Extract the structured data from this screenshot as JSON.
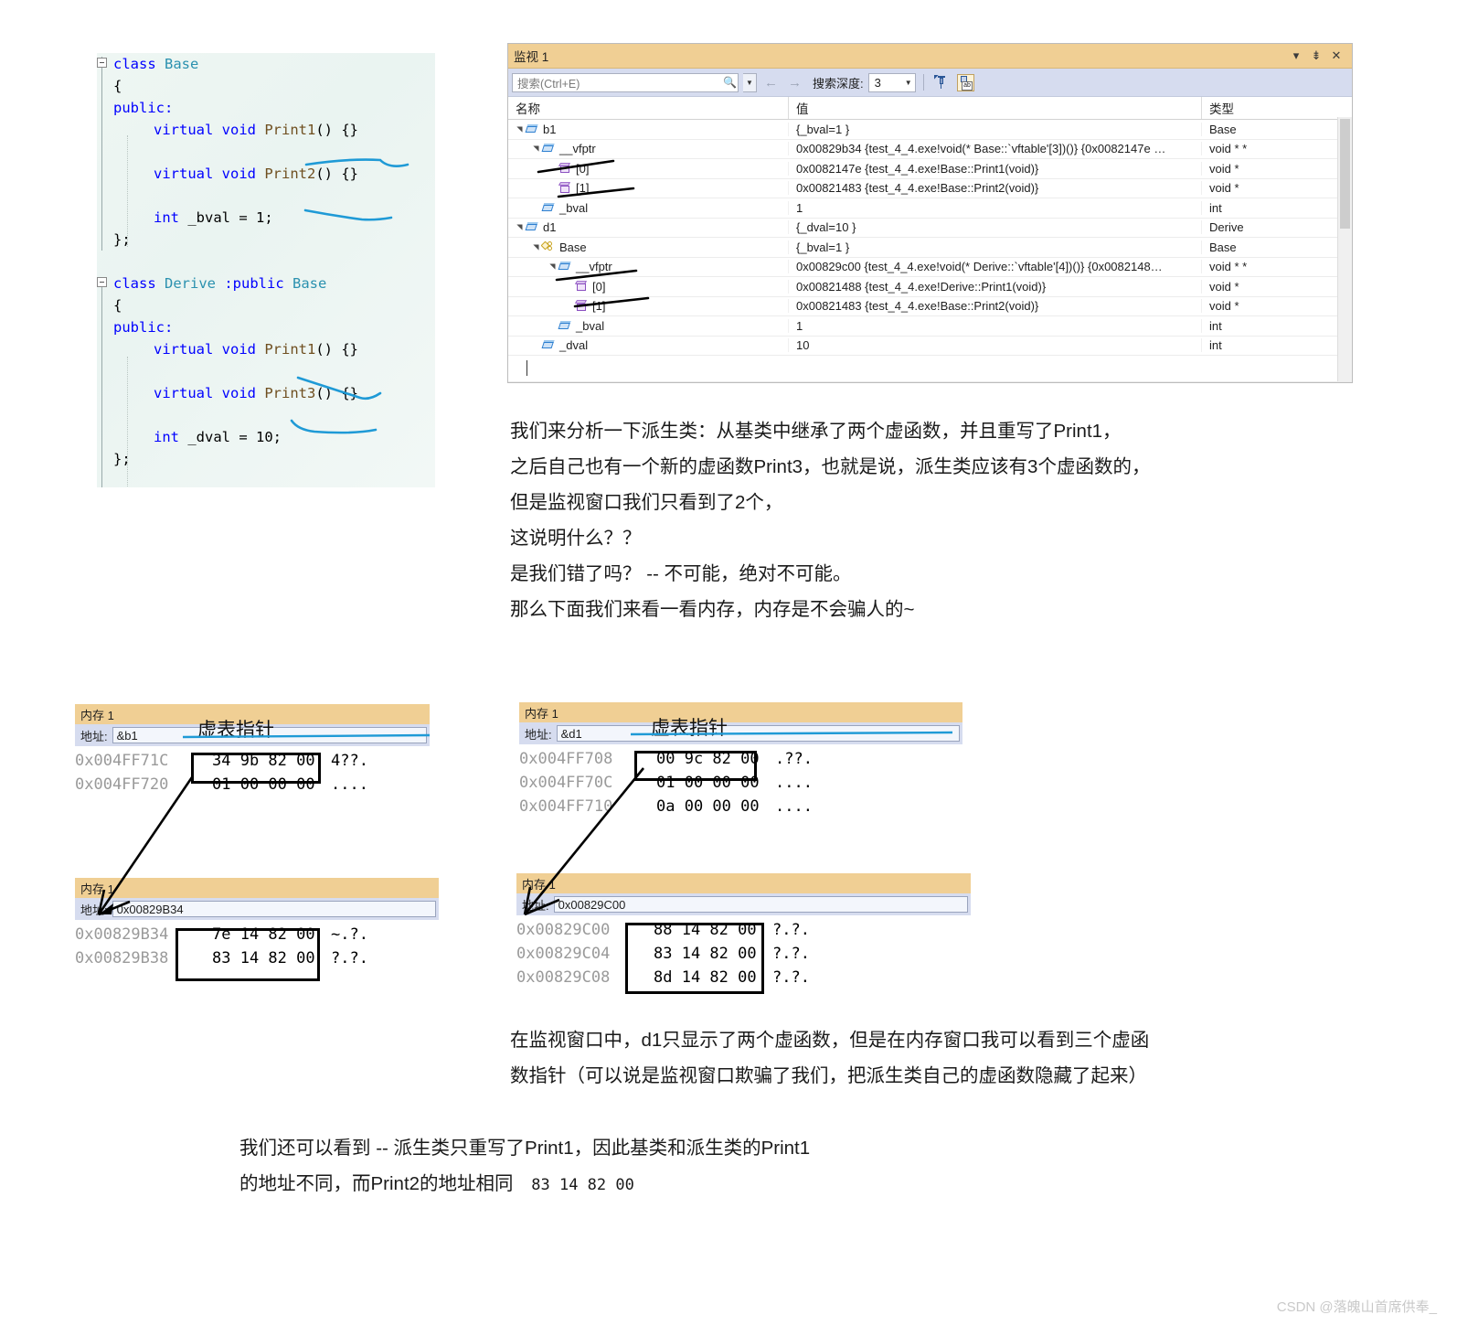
{
  "code_panel": {
    "lines": [
      {
        "indent": 0,
        "fold": true,
        "segs": [
          {
            "t": "class ",
            "c": "kw"
          },
          {
            "t": "Base",
            "c": "type"
          }
        ]
      },
      {
        "indent": 0,
        "fold": false,
        "segs": [
          {
            "t": "{",
            "c": "plain"
          }
        ]
      },
      {
        "indent": 0,
        "fold": false,
        "segs": [
          {
            "t": "public:",
            "c": "kw"
          }
        ]
      },
      {
        "indent": 1,
        "fold": false,
        "segs": [
          {
            "t": "virtual void ",
            "c": "kw"
          },
          {
            "t": "Print1",
            "c": "fn"
          },
          {
            "t": "() {}",
            "c": "plain"
          }
        ]
      },
      {
        "indent": 0,
        "fold": false,
        "segs": []
      },
      {
        "indent": 1,
        "fold": false,
        "segs": [
          {
            "t": "virtual void ",
            "c": "kw"
          },
          {
            "t": "Print2",
            "c": "fn"
          },
          {
            "t": "() {}",
            "c": "plain"
          }
        ]
      },
      {
        "indent": 0,
        "fold": false,
        "segs": []
      },
      {
        "indent": 1,
        "fold": false,
        "segs": [
          {
            "t": "int ",
            "c": "kw"
          },
          {
            "t": "_bval = 1;",
            "c": "plain"
          }
        ]
      },
      {
        "indent": 0,
        "fold": false,
        "segs": [
          {
            "t": "};",
            "c": "plain"
          }
        ]
      },
      {
        "indent": 0,
        "fold": false,
        "segs": []
      },
      {
        "indent": 0,
        "fold": true,
        "segs": [
          {
            "t": "class ",
            "c": "kw"
          },
          {
            "t": "Derive ",
            "c": "type"
          },
          {
            "t": ":public ",
            "c": "kw"
          },
          {
            "t": "Base",
            "c": "type"
          }
        ]
      },
      {
        "indent": 0,
        "fold": false,
        "segs": [
          {
            "t": "{",
            "c": "plain"
          }
        ]
      },
      {
        "indent": 0,
        "fold": false,
        "segs": [
          {
            "t": "public:",
            "c": "kw"
          }
        ]
      },
      {
        "indent": 1,
        "fold": false,
        "segs": [
          {
            "t": "virtual void ",
            "c": "kw"
          },
          {
            "t": "Print1",
            "c": "fn"
          },
          {
            "t": "() {}",
            "c": "plain"
          }
        ]
      },
      {
        "indent": 0,
        "fold": false,
        "segs": []
      },
      {
        "indent": 1,
        "fold": false,
        "segs": [
          {
            "t": "virtual void ",
            "c": "kw"
          },
          {
            "t": "Print3",
            "c": "fn"
          },
          {
            "t": "() {}",
            "c": "plain"
          }
        ]
      },
      {
        "indent": 0,
        "fold": false,
        "segs": []
      },
      {
        "indent": 1,
        "fold": false,
        "segs": [
          {
            "t": "int ",
            "c": "kw"
          },
          {
            "t": "_dval = 10;",
            "c": "plain"
          }
        ]
      },
      {
        "indent": 0,
        "fold": false,
        "segs": [
          {
            "t": "};",
            "c": "plain"
          }
        ]
      }
    ]
  },
  "watch": {
    "title": "监视 1",
    "dropdown_icon": "chevron-down-icon",
    "pin_icon": "pin-icon",
    "close_icon": "close-icon",
    "search_placeholder": "搜索(Ctrl+E)",
    "search_icon": "search-icon",
    "back_arrow": "←",
    "forward_arrow": "→",
    "depth_label": "搜索深度:",
    "depth_value": "3",
    "columns": [
      "名称",
      "值",
      "类型"
    ],
    "rows": [
      {
        "indent": 1,
        "expander": "expanded",
        "icon": "field",
        "name": "b1",
        "value": "{_bval=1 }",
        "type": "Base"
      },
      {
        "indent": 2,
        "expander": "expanded",
        "icon": "field",
        "name": "__vfptr",
        "value": "0x00829b34 {test_4_4.exe!void(* Base::`vftable'[3])()} {0x0082147e …",
        "type": "void * *"
      },
      {
        "indent": 3,
        "expander": "none",
        "icon": "cube",
        "name": "[0]",
        "value": "0x0082147e {test_4_4.exe!Base::Print1(void)}",
        "type": "void *"
      },
      {
        "indent": 3,
        "expander": "none",
        "icon": "cube",
        "name": "[1]",
        "value": "0x00821483 {test_4_4.exe!Base::Print2(void)}",
        "type": "void *"
      },
      {
        "indent": 2,
        "expander": "none",
        "icon": "field",
        "name": "_bval",
        "value": "1",
        "type": "int"
      },
      {
        "indent": 1,
        "expander": "expanded",
        "icon": "field",
        "name": "d1",
        "value": "{_dval=10 }",
        "type": "Derive"
      },
      {
        "indent": 2,
        "expander": "expanded",
        "icon": "base",
        "name": "Base",
        "value": "{_bval=1 }",
        "type": "Base"
      },
      {
        "indent": 3,
        "expander": "expanded",
        "icon": "field",
        "name": "__vfptr",
        "value": "0x00829c00 {test_4_4.exe!void(* Derive::`vftable'[4])()} {0x0082148…",
        "type": "void * *"
      },
      {
        "indent": 4,
        "expander": "none",
        "icon": "cube",
        "name": "[0]",
        "value": "0x00821488 {test_4_4.exe!Derive::Print1(void)}",
        "type": "void *"
      },
      {
        "indent": 4,
        "expander": "none",
        "icon": "cube",
        "name": "[1]",
        "value": "0x00821483 {test_4_4.exe!Base::Print2(void)}",
        "type": "void *"
      },
      {
        "indent": 3,
        "expander": "none",
        "icon": "field",
        "name": "_bval",
        "value": "1",
        "type": "int"
      },
      {
        "indent": 2,
        "expander": "none",
        "icon": "field",
        "name": "_dval",
        "value": "10",
        "type": "int"
      }
    ]
  },
  "paragraph1": [
    "我们来分析一下派生类：从基类中继承了两个虚函数，并且重写了Print1，",
    "之后自己也有一个新的虚函数Print3，也就是说，派生类应该有3个虚函数的，",
    "但是监视窗口我们只看到了2个，",
    "这说明什么？？",
    "是我们错了吗？ -- 不可能，绝对不可能。",
    "那么下面我们来看一看内存，内存是不会骗人的~"
  ],
  "memory_windows": [
    {
      "id": "mem-b1",
      "title": "内存 1",
      "addr_label": "地址:",
      "addr_value": "&b1",
      "annotation": "虚表指针",
      "rows": [
        {
          "addr": "0x004FF71C",
          "hex": "34 9b 82 00",
          "ascii": "4??."
        },
        {
          "addr": "0x004FF720",
          "hex": "01 00 00 00",
          "ascii": "...."
        }
      ]
    },
    {
      "id": "mem-d1",
      "title": "内存 1",
      "addr_label": "地址:",
      "addr_value": "&d1",
      "annotation": "虚表指针",
      "rows": [
        {
          "addr": "0x004FF708",
          "hex": "00 9c 82 00",
          "ascii": ".??."
        },
        {
          "addr": "0x004FF70C",
          "hex": "01 00 00 00",
          "ascii": "...."
        },
        {
          "addr": "0x004FF710",
          "hex": "0a 00 00 00",
          "ascii": "...."
        }
      ]
    },
    {
      "id": "mem-vtable-base",
      "title": "内存 1",
      "addr_label": "地址:",
      "addr_value": "0x00829B34",
      "annotation": "",
      "rows": [
        {
          "addr": "0x00829B34",
          "hex": "7e 14 82 00",
          "ascii": "~.?."
        },
        {
          "addr": "0x00829B38",
          "hex": "83 14 82 00",
          "ascii": "?.?."
        }
      ]
    },
    {
      "id": "mem-vtable-derive",
      "title": "内存 1",
      "addr_label": "地址:",
      "addr_value": "0x00829C00",
      "annotation": "",
      "rows": [
        {
          "addr": "0x00829C00",
          "hex": "88 14 82 00",
          "ascii": "?.?."
        },
        {
          "addr": "0x00829C04",
          "hex": "83 14 82 00",
          "ascii": "?.?."
        },
        {
          "addr": "0x00829C08",
          "hex": "8d 14 82 00",
          "ascii": "?.?."
        }
      ]
    }
  ],
  "paragraph2": [
    "在监视窗口中，d1只显示了两个虚函数，但是在内存窗口我可以看到三个虚函",
    "数指针（可以说是监视窗口欺骗了我们，把派生类自己的虚函数隐藏了起来）"
  ],
  "paragraph3": {
    "line1": "我们还可以看到 -- 派生类只重写了Print1，因此基类和派生类的Print1",
    "line2_text": "的地址不同，而Print2的地址相同",
    "line2_hex": "83 14 82 00"
  },
  "watermark": "CSDN @落魄山首席供奉_",
  "colors": {
    "title_bar": "#f0cf94",
    "toolbar": "#d6dcef",
    "keyword": "#0000ff",
    "type": "#2b91af",
    "function": "#6f4f20",
    "pen_blue": "#1f9ad6"
  }
}
